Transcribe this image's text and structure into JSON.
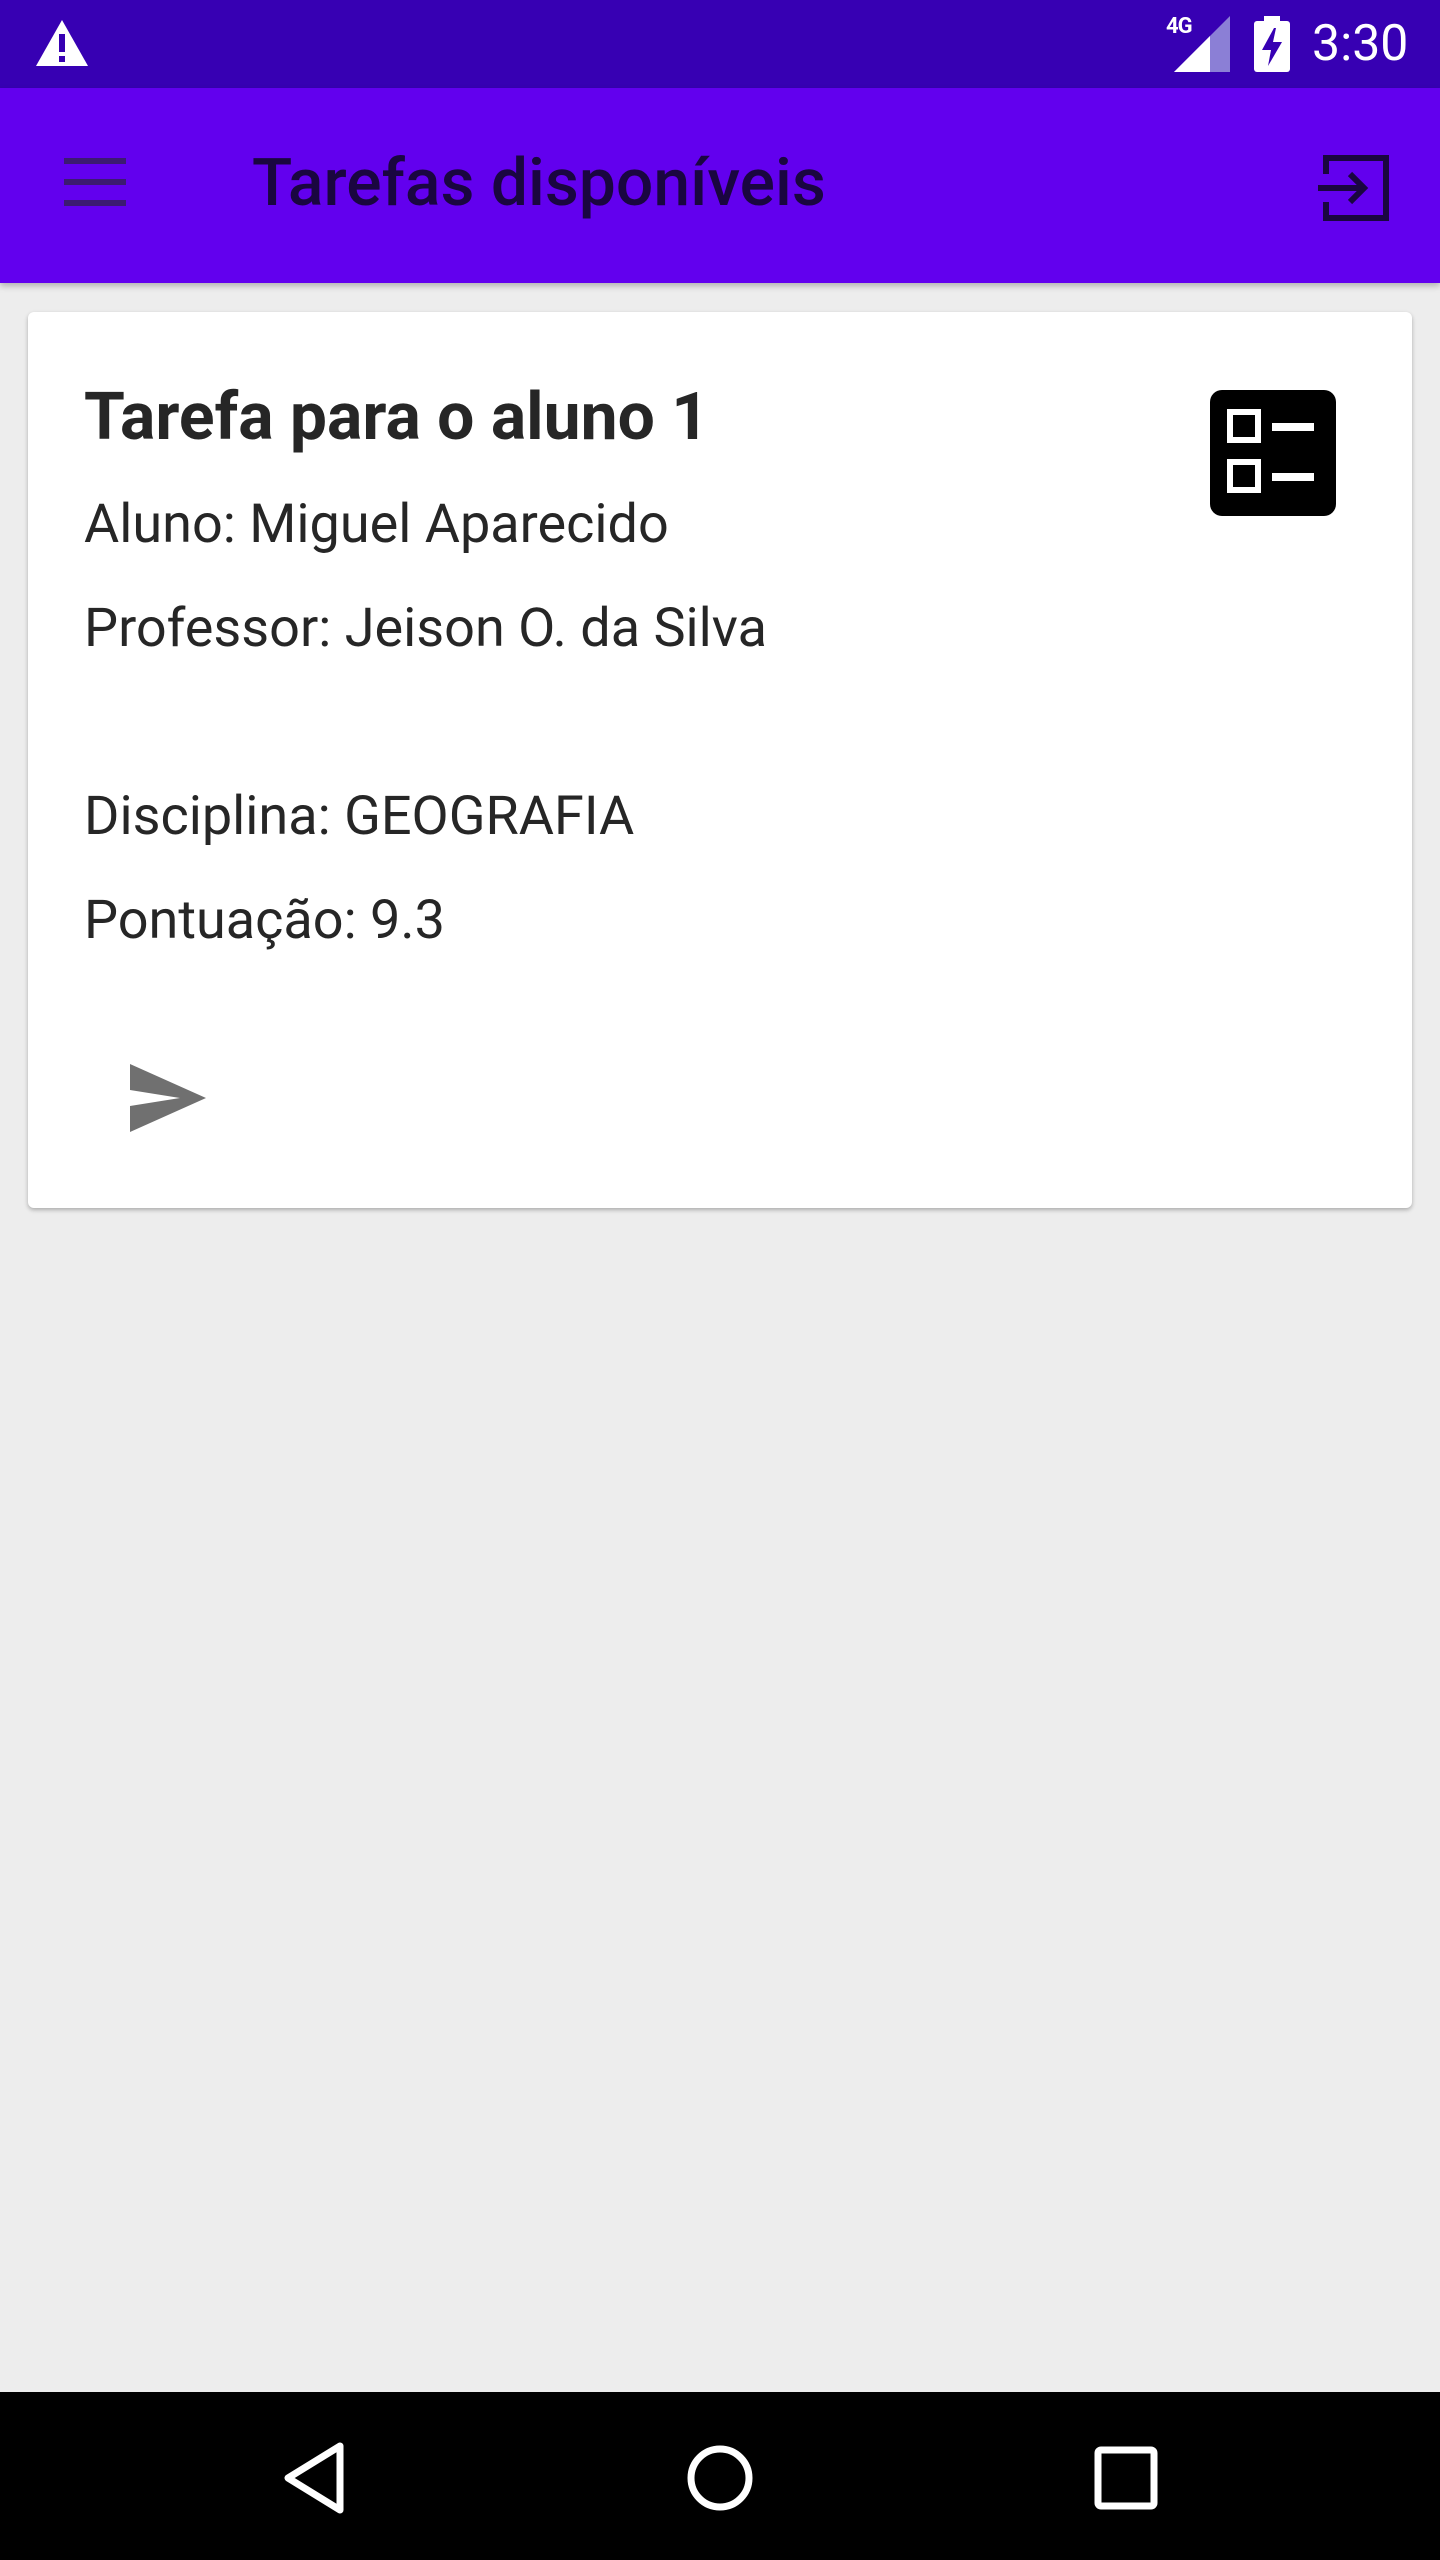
{
  "status_bar": {
    "network_label": "4G",
    "time": "3:30",
    "icons": [
      "warning-icon",
      "signal-icon",
      "battery-charging-icon"
    ]
  },
  "app_bar": {
    "title": "Tarefas disponíveis",
    "icons": [
      "menu-icon",
      "logout-icon"
    ],
    "background": "#6200ee",
    "status_background": "#3700b3"
  },
  "task_card": {
    "title": "Tarefa para o aluno 1",
    "student": "Aluno: Miguel Aparecido",
    "teacher": "Professor: Jeison O. da Silva",
    "subject": "Disciplina: GEOGRAFIA",
    "score": "Pontuação: 9.3",
    "icons": [
      "checklist-icon",
      "send-icon"
    ]
  },
  "nav_bar": {
    "icons": [
      "back-icon",
      "home-icon",
      "recents-icon"
    ]
  }
}
